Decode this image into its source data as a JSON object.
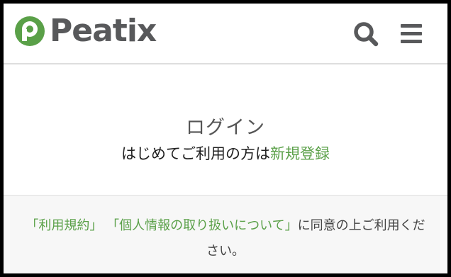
{
  "header": {
    "logo_text": "Peatix",
    "logo_color": "#58595b",
    "brand_green": "#5aa048",
    "search_icon": "search-icon",
    "menu_icon": "hamburger-menu-icon"
  },
  "login": {
    "title": "ログイン",
    "signup_prefix": "はじめてご利用の方は",
    "signup_link": "新規登録"
  },
  "footer": {
    "terms_link": "「利用規約」",
    "privacy_link": "「個人情報の取り扱いについて」",
    "agreement_text": "に同意の上ご利用ください。"
  }
}
